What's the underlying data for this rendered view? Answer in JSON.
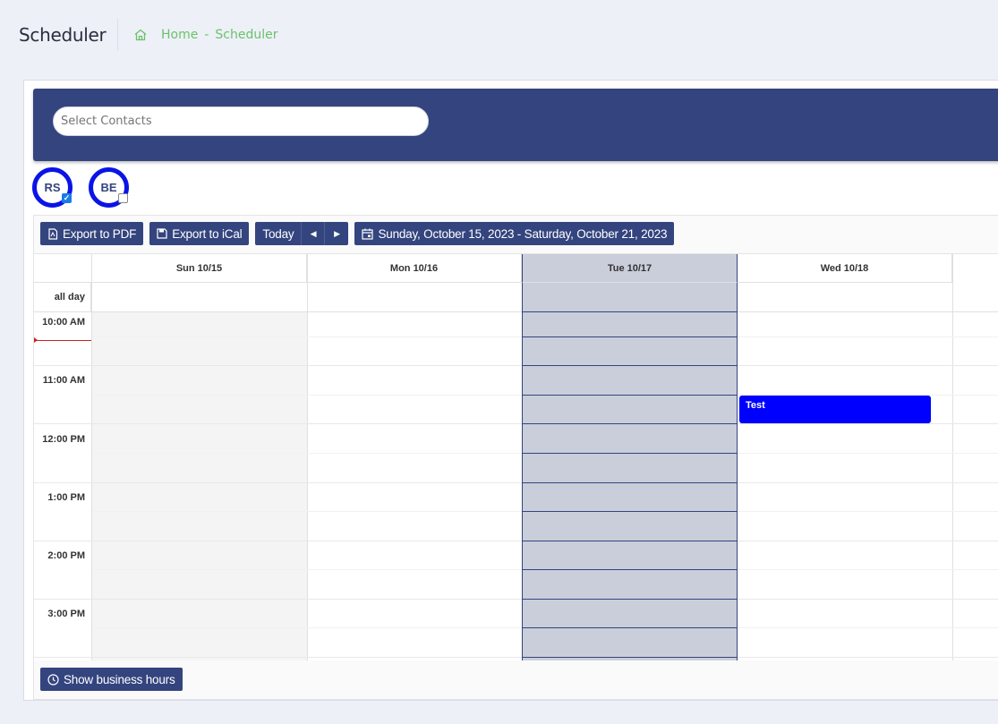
{
  "header": {
    "title": "Scheduler",
    "breadcrumb": [
      "Home",
      "Scheduler"
    ],
    "breadcrumb_separator": "-"
  },
  "contacts": {
    "placeholder": "Select Contacts",
    "avatars": [
      {
        "initials": "RS",
        "checked": true
      },
      {
        "initials": "BE",
        "checked": false
      }
    ]
  },
  "toolbar": {
    "export_pdf": "Export to PDF",
    "export_ical": "Export to iCal",
    "today": "Today",
    "prev": "◀",
    "next": "▶",
    "range": "Sunday, October 15, 2023 - Saturday, October 21, 2023"
  },
  "calendar": {
    "days": [
      "Sun 10/15",
      "Mon 10/16",
      "Tue 10/17",
      "Wed 10/18"
    ],
    "today_index": 2,
    "all_day_label": "all day",
    "times": [
      "10:00 AM",
      "11:00 AM",
      "12:00 PM",
      "1:00 PM",
      "2:00 PM",
      "3:00 PM"
    ],
    "events": [
      {
        "title": "Test",
        "day": "Wed 10/18",
        "start": "11:30 AM",
        "end": "12:00 PM",
        "color": "#0000ff"
      }
    ]
  },
  "footer": {
    "business_hours": "Show business hours"
  },
  "colors": {
    "accent": "#34447e",
    "breadcrumb": "#6ac26a",
    "event": "#0000ff",
    "avatar_ring": "#0a14e6",
    "today_bg": "#c9ceda"
  }
}
